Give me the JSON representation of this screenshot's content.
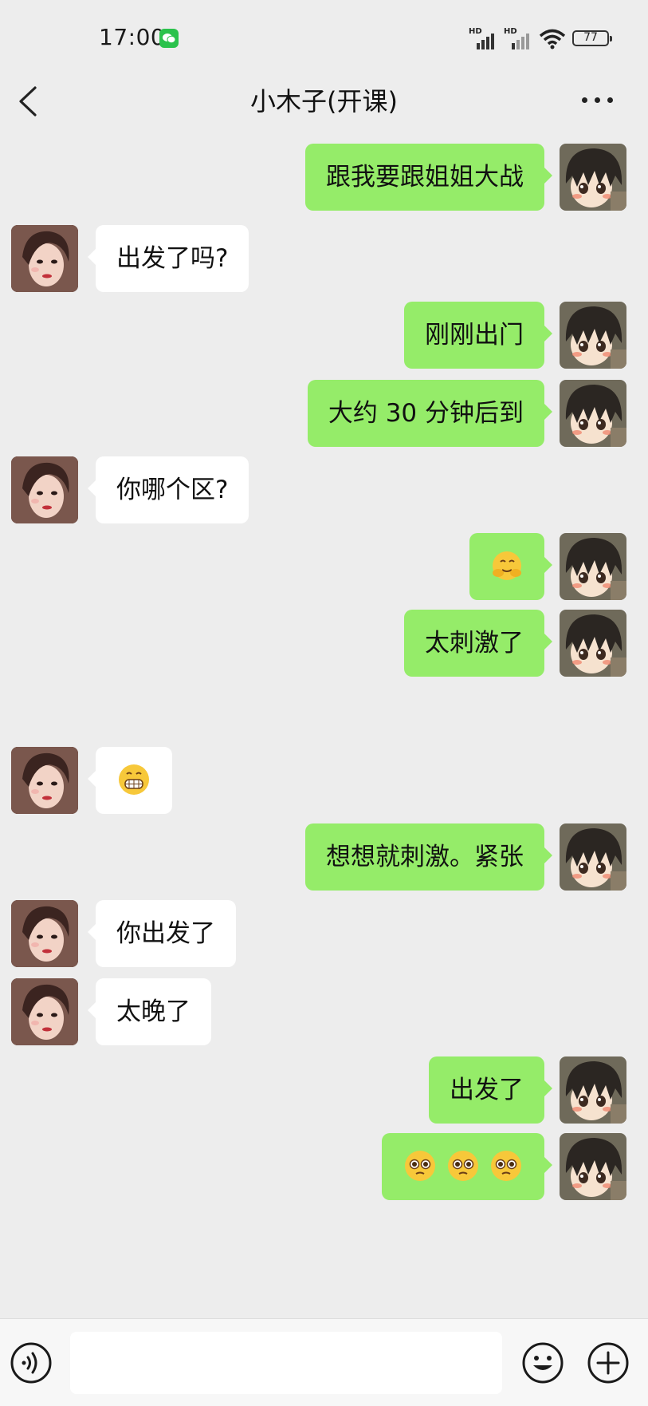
{
  "status_bar": {
    "time": "17:00",
    "signal_1_label": "HD",
    "signal_2_label": "HD",
    "battery": "77"
  },
  "header": {
    "title": "小木子(开课)"
  },
  "messages": [
    {
      "side": "right",
      "text": "跟我要跟姐姐大战"
    },
    {
      "side": "left",
      "text": "出发了吗?"
    },
    {
      "side": "right",
      "text": "刚刚出门"
    },
    {
      "side": "right",
      "text": "大约 30 分钟后到"
    },
    {
      "side": "left",
      "text": "你哪个区?"
    },
    {
      "side": "right",
      "emoji": "hug-face-emoji"
    },
    {
      "side": "right",
      "text": "太刺激了"
    },
    {
      "side": "left",
      "emoji": "grin-face-emoji"
    },
    {
      "side": "right",
      "text": "想想就刺激。紧张"
    },
    {
      "side": "left",
      "text": "你出发了"
    },
    {
      "side": "left",
      "text": "太晚了"
    },
    {
      "side": "right",
      "text": "出发了"
    },
    {
      "side": "right",
      "emoji": "pleading-face-emoji x3"
    }
  ],
  "input": {
    "placeholder": ""
  },
  "colors": {
    "background": "#ededed",
    "own_bubble": "#95ec69",
    "other_bubble": "#ffffff",
    "wechat_green": "#2bc24c"
  }
}
